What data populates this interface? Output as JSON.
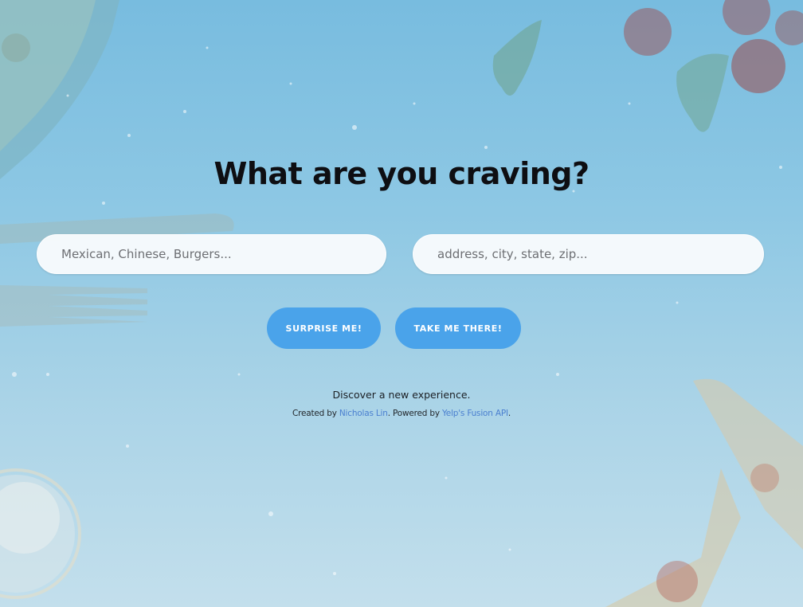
{
  "hero": {
    "title": "What are you craving?"
  },
  "search": {
    "food_placeholder": "Mexican, Chinese, Burgers...",
    "location_placeholder": "address, city, state, zip..."
  },
  "actions": {
    "surprise_label": "SURPRISE ME!",
    "take_me_label": "TAKE ME THERE!"
  },
  "footer": {
    "tagline": "Discover a new experience.",
    "created_by_prefix": "Created by",
    "author_link": "Nicholas Lin",
    "powered_by_prefix": ". Powered by",
    "api_link": "Yelp's Fusion API",
    "suffix": "."
  },
  "colors": {
    "button_background": "#4aa3ea",
    "button_text": "#ffffff",
    "link": "#4a7fd0",
    "title": "#0e0e12",
    "background": "#8ec8e4"
  },
  "icons": {
    "background_image": "food-ingredients-photo"
  }
}
